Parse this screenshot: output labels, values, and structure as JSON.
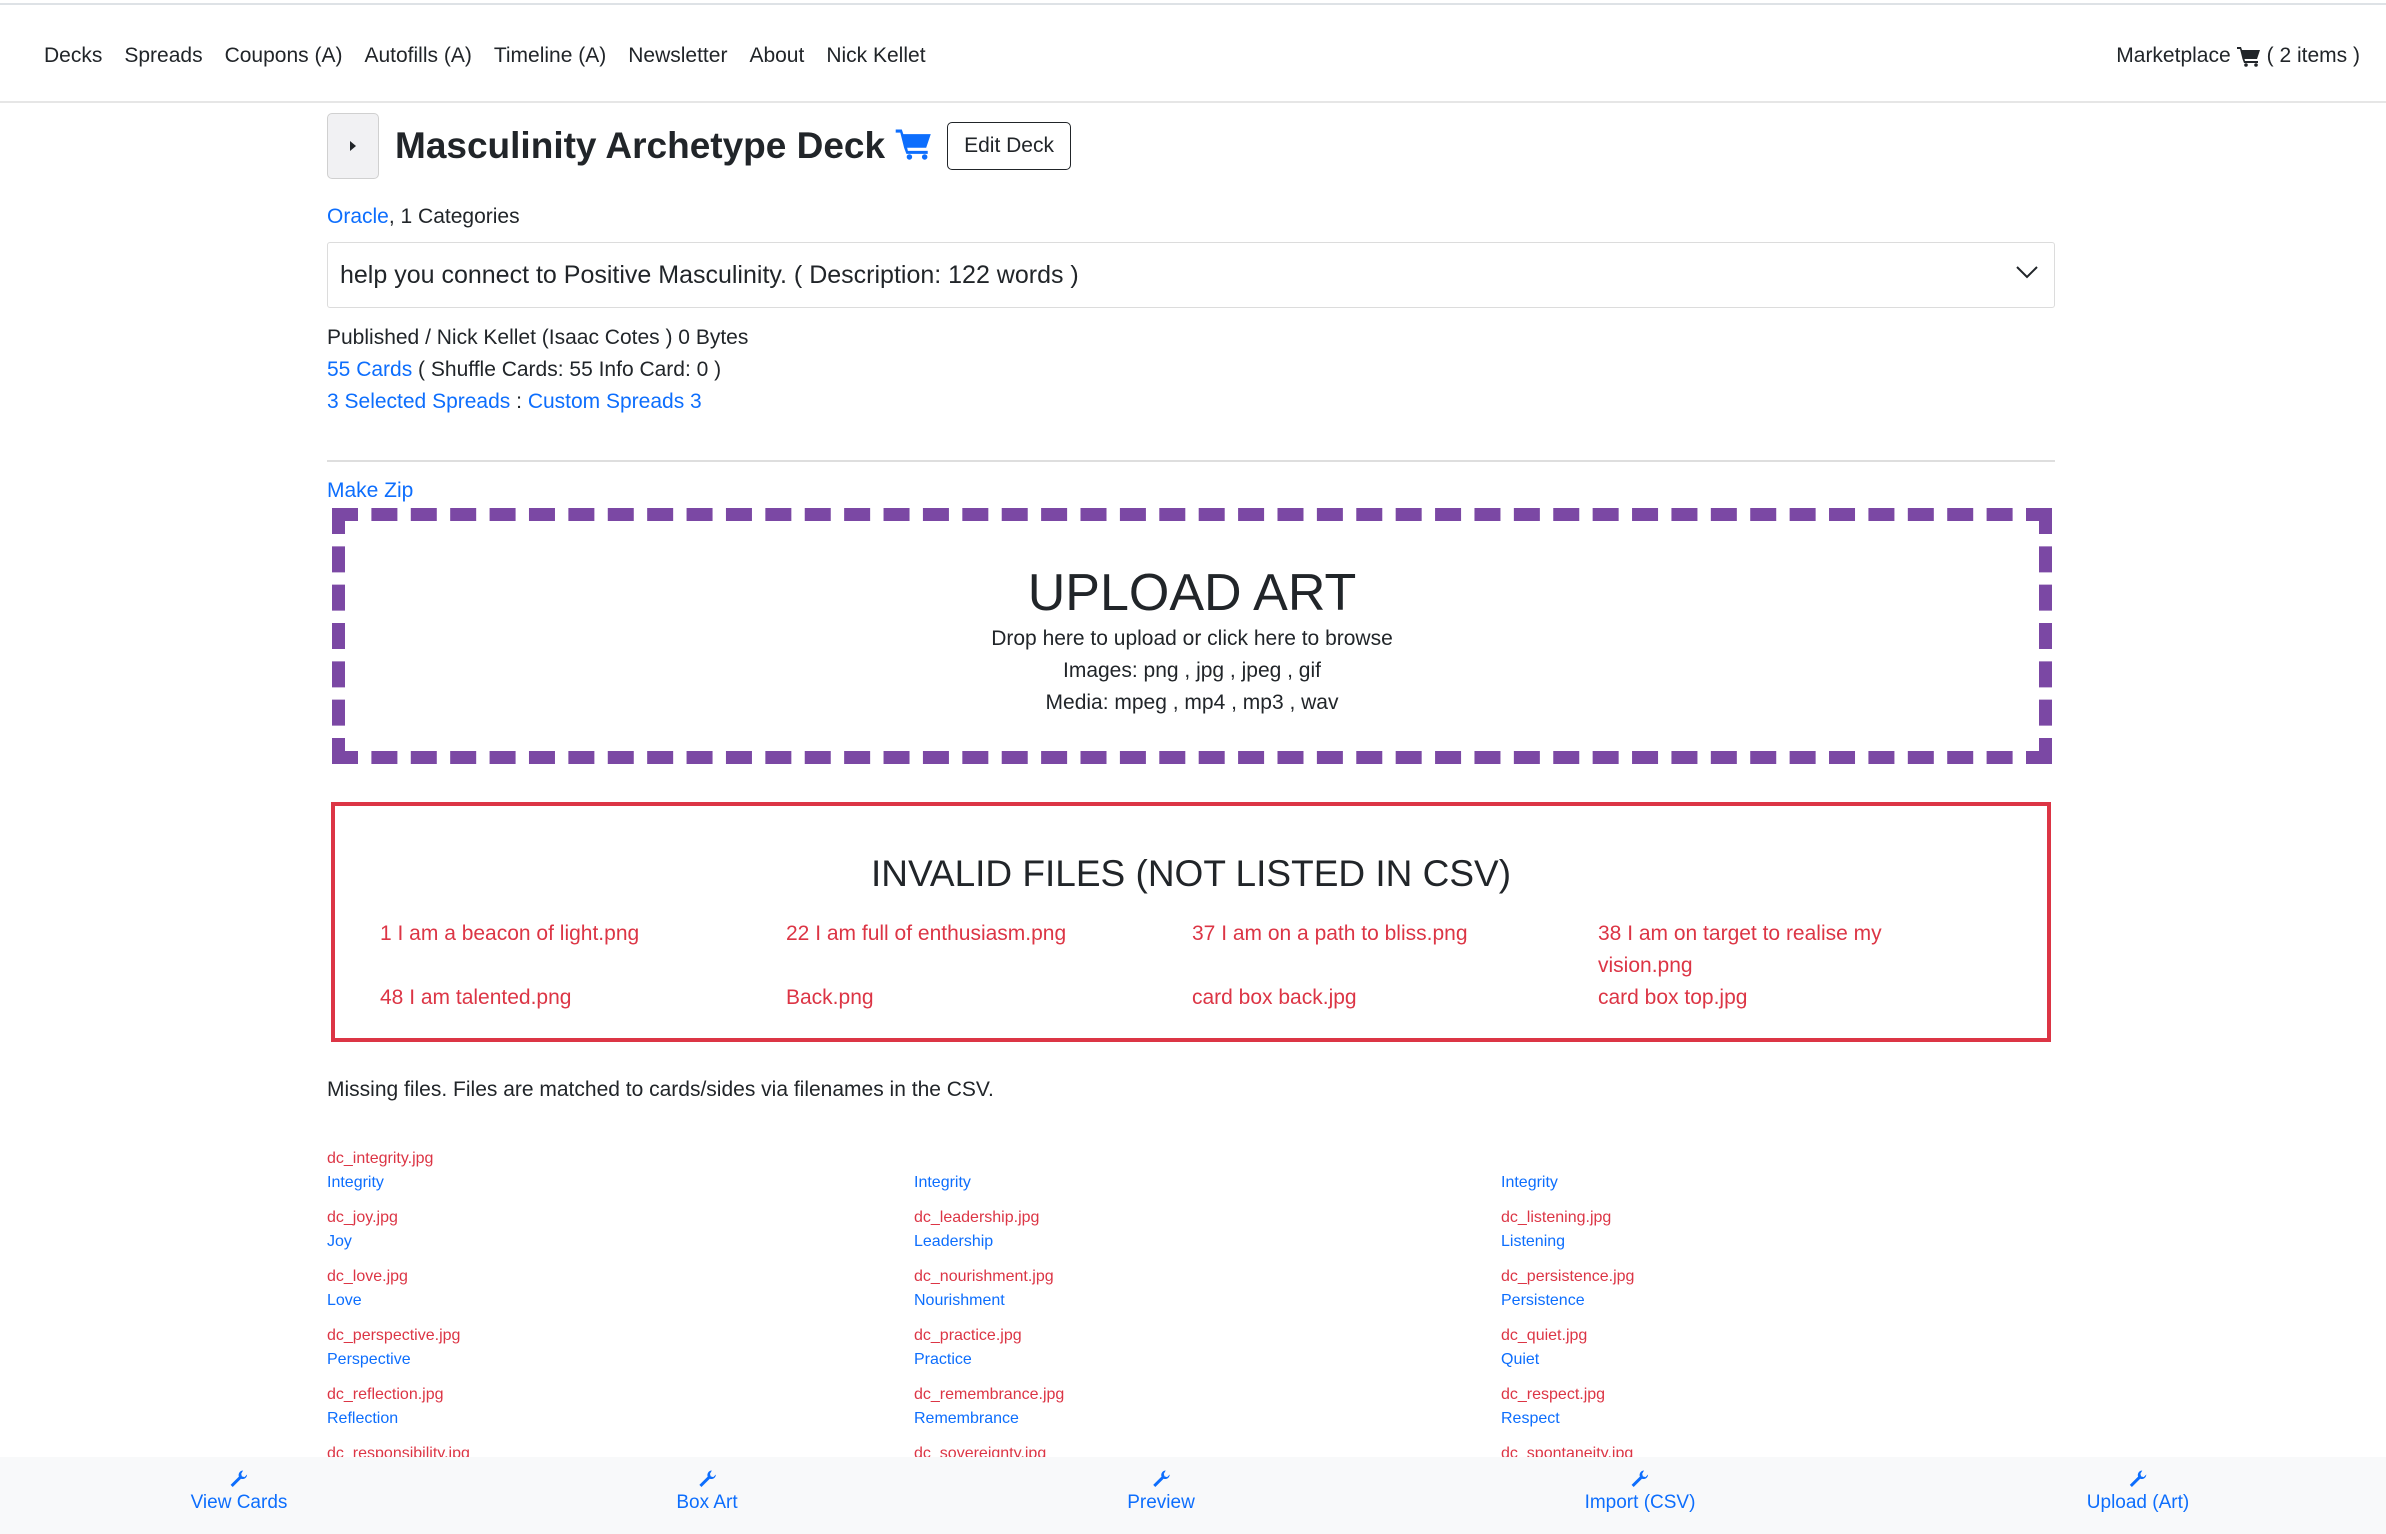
{
  "nav": {
    "items": [
      "Decks",
      "Spreads",
      "Coupons (A)",
      "Autofills (A)",
      "Timeline (A)",
      "Newsletter",
      "About",
      "Nick Kellet"
    ],
    "marketplace": "Marketplace",
    "cart_count": "( 2 items )"
  },
  "deck": {
    "title": "Masculinity Archetype Deck",
    "edit_label": "Edit Deck",
    "category_link": "Oracle",
    "categories_text": ", 1 Categories",
    "description": "help you connect to Positive Masculinity. ( Description: 122 words )",
    "published_line": "Published / Nick Kellet (Isaac Cotes ) 0 Bytes",
    "cards_link": "55 Cards",
    "cards_detail": " ( Shuffle Cards: 55 Info Card: 0 )",
    "spreads_link": "3 Selected Spreads",
    "spreads_sep": " : ",
    "custom_spreads_link": "Custom Spreads 3",
    "make_zip": "Make Zip"
  },
  "upload": {
    "title": "UPLOAD ART",
    "line1": "Drop here to upload or click here to browse",
    "line2": "Images: png , jpg , jpeg , gif",
    "line3": "Media: mpeg , mp4 , mp3 , wav"
  },
  "invalid": {
    "title": "INVALID FILES (NOT LISTED IN CSV)",
    "files": [
      "1 I am a beacon of light.png",
      "22 I am full of enthusiasm.png",
      "37 I am on a path to bliss.png",
      "38 I am on target to realise my vision.png",
      "48 I am talented.png",
      "Back.png",
      "card box back.jpg",
      "card box top.jpg"
    ]
  },
  "missing": {
    "note": "Missing files. Files are matched to cards/sides via filenames in the CSV.",
    "items": [
      {
        "file": "dc_integrity.jpg",
        "card": "Integrity"
      },
      {
        "file": "",
        "card": "Integrity"
      },
      {
        "file": "",
        "card": "Integrity"
      },
      {
        "file": "dc_joy.jpg",
        "card": "Joy"
      },
      {
        "file": "dc_leadership.jpg",
        "card": "Leadership"
      },
      {
        "file": "dc_listening.jpg",
        "card": "Listening"
      },
      {
        "file": "dc_love.jpg",
        "card": "Love"
      },
      {
        "file": "dc_nourishment.jpg",
        "card": "Nourishment"
      },
      {
        "file": "dc_persistence.jpg",
        "card": "Persistence"
      },
      {
        "file": "dc_perspective.jpg",
        "card": "Perspective"
      },
      {
        "file": "dc_practice.jpg",
        "card": "Practice"
      },
      {
        "file": "dc_quiet.jpg",
        "card": "Quiet"
      },
      {
        "file": "dc_reflection.jpg",
        "card": "Reflection"
      },
      {
        "file": "dc_remembrance.jpg",
        "card": "Remembrance"
      },
      {
        "file": "dc_respect.jpg",
        "card": "Respect"
      },
      {
        "file": "dc_responsibility.jpg",
        "card": ""
      },
      {
        "file": "dc_sovereignty.jpg",
        "card": ""
      },
      {
        "file": "dc_spontaneity.jpg",
        "card": ""
      }
    ]
  },
  "bottom": {
    "items": [
      "View Cards",
      "Box Art",
      "Preview",
      "Import (CSV)",
      "Upload (Art)"
    ]
  },
  "colors": {
    "link": "#0d6efd",
    "danger": "#dc3545",
    "upload_border": "#7b48a4"
  }
}
